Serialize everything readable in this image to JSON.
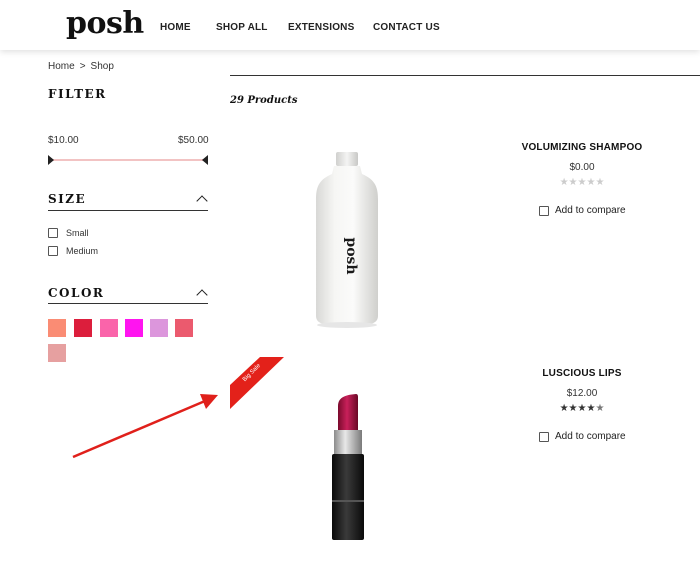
{
  "logo": "posh",
  "nav": [
    "HOME",
    "SHOP ALL",
    "EXTENSIONS",
    "CONTACT US"
  ],
  "breadcrumb": {
    "home": "Home",
    "separator": ">",
    "current": "Shop"
  },
  "filter": {
    "title": "FILTER",
    "price_min": "$10.00",
    "price_max": "$50.00",
    "size_title": "SIZE",
    "size_options": [
      "Small",
      "Medium"
    ],
    "color_title": "COLOR",
    "colors": [
      "#fa8c74",
      "#dc1e3c",
      "#fa64aa",
      "#ff14f0",
      "#dc96dc",
      "#eb5a6e",
      "#e6a0a0"
    ]
  },
  "products_count": "29 Products",
  "products": [
    {
      "name": "VOLUMIZING SHAMPOO",
      "price": "$0.00",
      "rating": 0,
      "compare": "Add to compare",
      "bottle_text": "posh"
    },
    {
      "name": "LUSCIOUS LIPS",
      "price": "$12.00",
      "rating": 4.5,
      "compare": "Add to compare",
      "badge": "Big Sale"
    }
  ],
  "accent_color": "#e0201b"
}
